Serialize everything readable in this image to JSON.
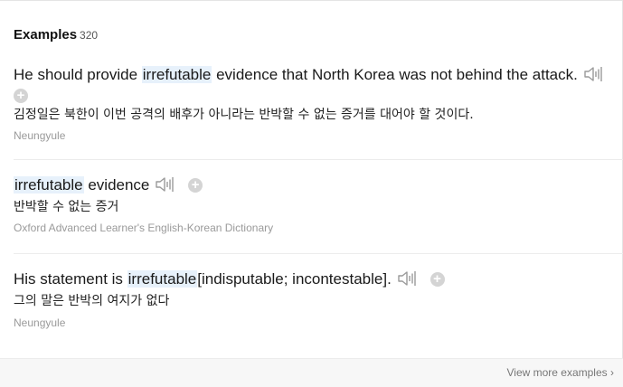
{
  "section": {
    "title": "Examples",
    "count": "320"
  },
  "examples": [
    {
      "en_pre": "He should provide ",
      "en_hl": "irrefutable",
      "en_post": " evidence that North Korea was not behind the attack.",
      "ko": "김정일은 북한이 이번 공격의 배후가 아니라는 반박할 수 없는 증거를 대어야 할 것이다.",
      "source": "Neungyule"
    },
    {
      "en_pre": "",
      "en_hl": "irrefutable",
      "en_post": " evidence",
      "ko": "반박할 수 없는 증거",
      "source": "Oxford Advanced Learner's English-Korean Dictionary"
    },
    {
      "en_pre": "His statement is ",
      "en_hl": "irrefutable",
      "en_post": "[indisputable; incontestable].",
      "ko": "그의 말은 반박의 여지가 없다",
      "source": "Neungyule"
    }
  ],
  "footer": {
    "view_more": "View more examples",
    "chevron": "›"
  },
  "icons": {
    "speaker": "speaker-icon",
    "add": "add-icon"
  },
  "colors": {
    "highlight": "#e7f1fb",
    "source_text": "#9a9a9a",
    "icon_gray": "#b0b0b0"
  }
}
